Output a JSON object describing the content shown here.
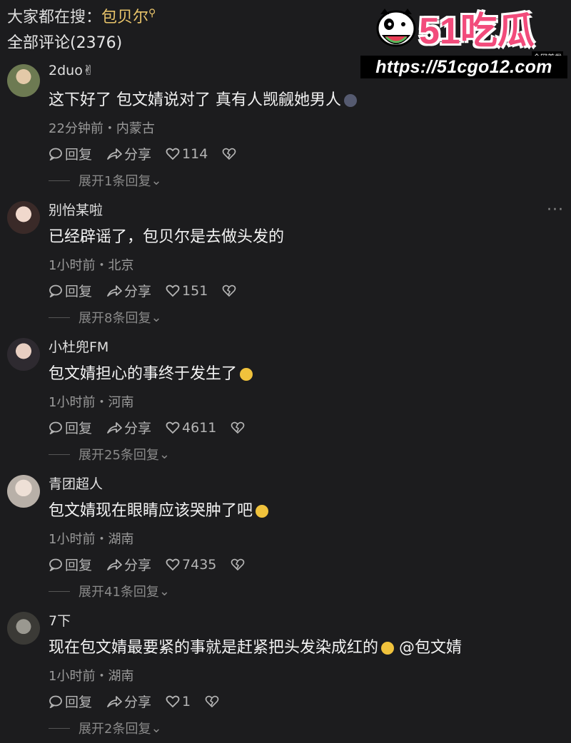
{
  "search": {
    "prefix": "大家都在搜：",
    "keyword": "包贝尔",
    "icon": "search-icon"
  },
  "comments_count": "全部评论(2376)",
  "watermark": {
    "brand": "51吃瓜",
    "tag": "全网首发",
    "url": "https://51cgo12.com"
  },
  "actions": {
    "reply": "回复",
    "share": "分享"
  },
  "comments": [
    {
      "user": "2duo✌",
      "text": "这下好了 包文婧说对了 真有人觊觎她男人",
      "emoji_color": "#555a70",
      "meta": "22分钟前・内蒙古",
      "likes": "114",
      "expand": "展开1条回复"
    },
    {
      "user": "别怡某啦",
      "text": "已经辟谣了，包贝尔是去做头发的",
      "emoji_color": "",
      "meta": "1小时前・北京",
      "likes": "151",
      "expand": "展开8条回复"
    },
    {
      "user": "小杜兜FM",
      "text": "包文婧担心的事终于发生了",
      "emoji_color": "#f0c23c",
      "meta": "1小时前・河南",
      "likes": "4611",
      "expand": "展开25条回复"
    },
    {
      "user": "青团超人",
      "text": "包文婧现在眼睛应该哭肿了吧",
      "emoji_color": "#f0c23c",
      "meta": "1小时前・湖南",
      "likes": "7435",
      "expand": "展开41条回复"
    },
    {
      "user": "7下",
      "text": "现在包文婧最要紧的事就是赶紧把头发染成红的",
      "text_suffix": "@包文婧",
      "emoji_color": "#f0c23c",
      "meta": "1小时前・湖南",
      "likes": "1",
      "expand": "展开2条回复"
    }
  ]
}
